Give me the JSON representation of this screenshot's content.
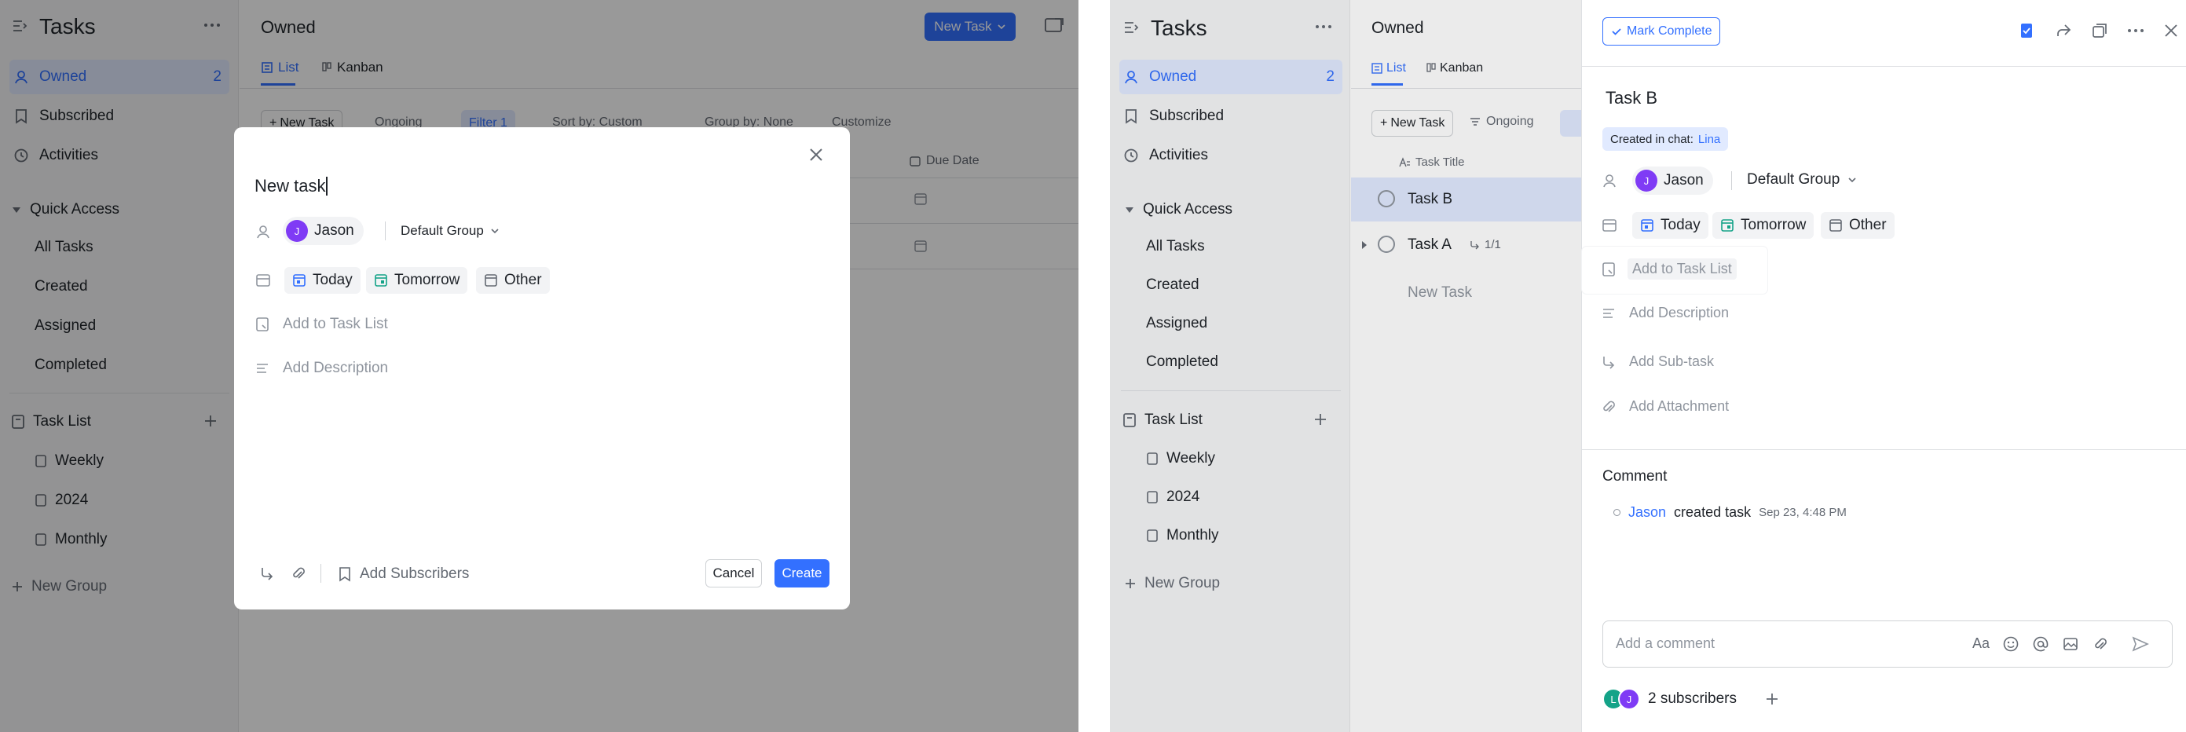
{
  "left": {
    "app_title": "Tasks",
    "sidebar": {
      "owned_label": "Owned",
      "owned_count": "2",
      "subscribed_label": "Subscribed",
      "activities_label": "Activities",
      "quick_access_label": "Quick Access",
      "quick_items": [
        "All Tasks",
        "Created",
        "Assigned",
        "Completed"
      ],
      "task_list_label": "Task List",
      "lists": [
        "Weekly",
        "2024",
        "Monthly"
      ],
      "new_group_label": "New Group"
    },
    "header": {
      "title": "Owned",
      "new_task_button": "New Task",
      "tab_list": "List",
      "tab_kanban": "Kanban"
    },
    "toolbar": {
      "new_task": "New Task",
      "ongoing": "Ongoing",
      "filter": "Filter 1",
      "sort": "Sort by: Custom",
      "group": "Group by: None",
      "customize": "Customize"
    },
    "table": {
      "due_date_header": "Due Date"
    },
    "modal": {
      "title_value": "New task",
      "assignee": "Jason",
      "assignee_initial": "J",
      "group": "Default Group",
      "date_today": "Today",
      "date_tomorrow": "Tomorrow",
      "date_other": "Other",
      "add_to_task_list": "Add to Task List",
      "add_description": "Add Description",
      "add_subscribers": "Add Subscribers",
      "cancel": "Cancel",
      "create": "Create"
    }
  },
  "right": {
    "app_title": "Tasks",
    "sidebar": {
      "owned_label": "Owned",
      "owned_count": "2",
      "subscribed_label": "Subscribed",
      "activities_label": "Activities",
      "quick_access_label": "Quick Access",
      "quick_items": [
        "All Tasks",
        "Created",
        "Assigned",
        "Completed"
      ],
      "task_list_label": "Task List",
      "lists": [
        "Weekly",
        "2024",
        "Monthly"
      ],
      "new_group_label": "New Group"
    },
    "main": {
      "title": "Owned",
      "tab_list": "List",
      "tab_kanban": "Kanban",
      "new_task": "New Task",
      "ongoing": "Ongoing",
      "column_task_title": "Task Title",
      "tasks": [
        {
          "title": "Task B",
          "subtasks": ""
        },
        {
          "title": "Task A",
          "subtasks": "1/1"
        }
      ],
      "new_task_row": "New Task"
    },
    "detail": {
      "mark_complete": "Mark Complete",
      "task_title": "Task B",
      "created_in_chat_prefix": "Created in chat:",
      "created_in_chat_name": "Lina",
      "assignee": "Jason",
      "assignee_initial": "J",
      "group": "Default Group",
      "date_today": "Today",
      "date_tomorrow": "Tomorrow",
      "date_other": "Other",
      "add_to_task_list": "Add to Task List",
      "add_description": "Add Description",
      "add_subtask": "Add Sub-task",
      "add_attachment": "Add Attachment",
      "comment_heading": "Comment",
      "activity_user": "Jason",
      "activity_text": "created task",
      "activity_time": "Sep 23, 4:48 PM",
      "comment_placeholder": "Add a comment",
      "subscribers_text": "2 subscribers",
      "subscriber_initials": [
        "L",
        "J"
      ]
    }
  },
  "colors": {
    "accent": "#3370ff",
    "sidebar_bg": "#f5f6f7",
    "active_bg": "#e1eaff",
    "avatar_purple": "#7f3bf5",
    "avatar_teal": "#14a388",
    "chip_bg": "#f2f3f5"
  }
}
